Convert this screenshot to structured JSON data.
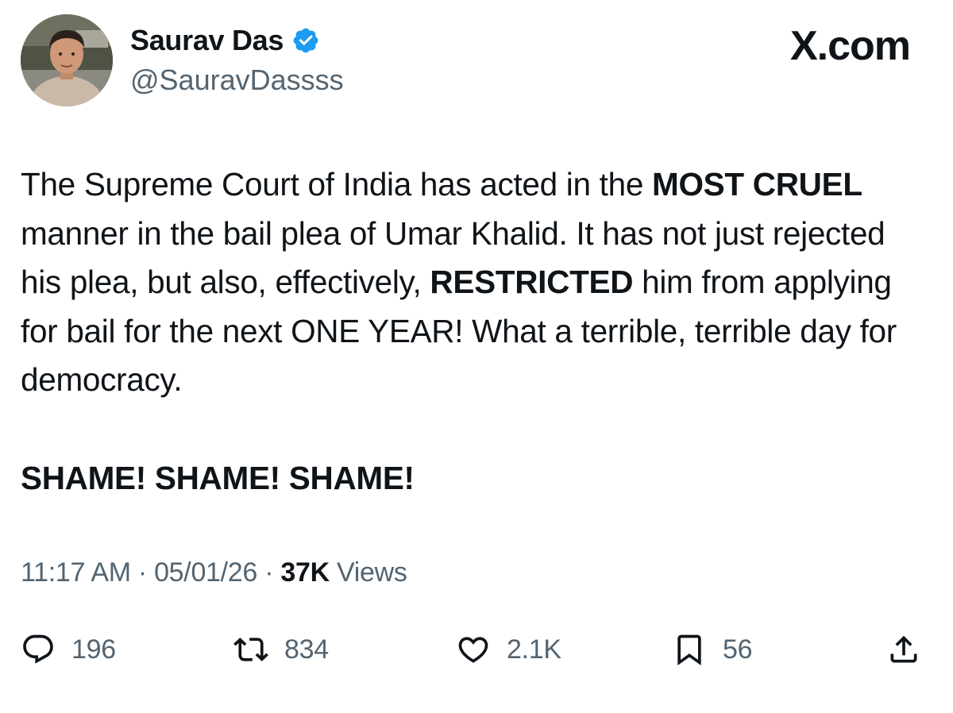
{
  "author": {
    "display_name": "Saurav Das",
    "handle": "@SauravDassss",
    "verified": true,
    "avatar_icon": "avatar-photo"
  },
  "brand": "X.com",
  "tweet": {
    "segments": [
      {
        "text": "The Supreme Court of India has acted in the ",
        "bold": false
      },
      {
        "text": "MOST CRUEL",
        "bold": true
      },
      {
        "text": " manner in the bail plea of Umar Khalid. It has not just rejected his plea, but also, effectively, ",
        "bold": false
      },
      {
        "text": "RESTRICTED",
        "bold": true
      },
      {
        "text": " him from applying for bail for the next ONE YEAR! What a terrible, terrible day for democracy.",
        "bold": false
      }
    ],
    "closing": "SHAME! SHAME! SHAME!"
  },
  "meta": {
    "time": "11:17 AM",
    "separator": "·",
    "date": "05/01/26",
    "views_count": "37K",
    "views_label": "Views"
  },
  "actions": {
    "replies": {
      "icon": "reply-icon",
      "count": "196"
    },
    "reposts": {
      "icon": "repost-icon",
      "count": "834"
    },
    "likes": {
      "icon": "heart-icon",
      "count": "2.1K"
    },
    "bookmarks": {
      "icon": "bookmark-icon",
      "count": "56"
    },
    "share": {
      "icon": "share-icon"
    }
  },
  "colors": {
    "text": "#0f1419",
    "secondary": "#536471",
    "verified_badge": "#1d9bf0"
  }
}
